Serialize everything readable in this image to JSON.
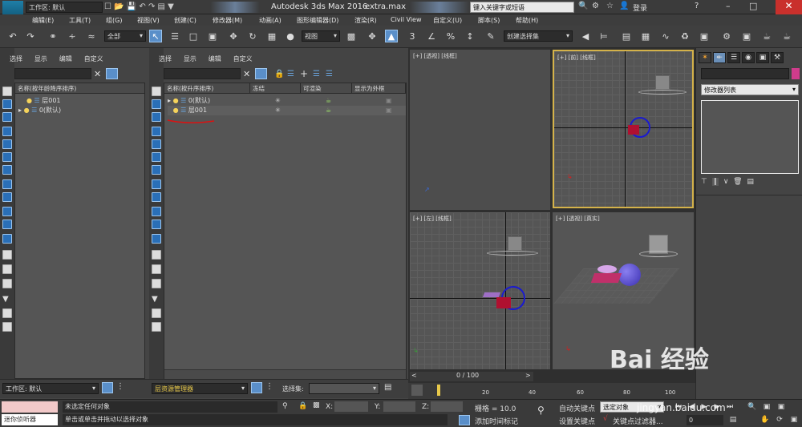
{
  "titlebar": {
    "workspace": "工作区: 默认",
    "app_title": "Autodesk 3ds Max 2016",
    "file_name": "extra.max",
    "search_placeholder": "键入关键字或短语",
    "login": "登录"
  },
  "logo": "MAX",
  "menu": [
    "编辑(E)",
    "工具(T)",
    "组(G)",
    "视图(V)",
    "创建(C)",
    "修改器(M)",
    "动画(A)",
    "图形编辑器(D)",
    "渲染(R)",
    "Civil View",
    "自定义(U)",
    "脚本(S)",
    "帮助(H)"
  ],
  "toolbar": {
    "filter_value": "全部",
    "ref_coord": "视图",
    "create_selection_set": "创建选择集"
  },
  "left_explorer": {
    "tabs": [
      "选择",
      "显示",
      "编辑",
      "自定义"
    ],
    "column_header": "名称(按年龄降序排序)",
    "rows": [
      {
        "name": "层001",
        "expanded": false,
        "indent": 1
      },
      {
        "name": "0(默认)",
        "expanded": false,
        "indent": 0
      }
    ],
    "workspace_label": "工作区: 默认"
  },
  "layer_manager": {
    "tabs": [
      "选择",
      "显示",
      "编辑",
      "自定义"
    ],
    "columns": [
      "名称(按升序排序)",
      "冻结",
      "可渲染",
      "显示为外框"
    ],
    "rows": [
      {
        "name": "0(默认)",
        "expanded": false
      },
      {
        "name": "层001",
        "expanded": false
      }
    ],
    "footer_label": "层资源管理器",
    "selection_set_label": "选择集:"
  },
  "viewports": {
    "top": "[+] [透视] [线框]",
    "front": "[+] [前] [线框]",
    "left": "[+] [左] [线框]",
    "perspective": "[+] [透视] [真实]"
  },
  "command_panel": {
    "modifier_list": "修改器列表"
  },
  "timeline": {
    "frame": "0 / 100",
    "ticks": [
      "20",
      "40",
      "60",
      "80",
      "100"
    ]
  },
  "status": {
    "listener": "迷你侦听器",
    "selection": "未选定任何对象",
    "prompt": "单击或单击并拖动以选择对象",
    "x_label": "X:",
    "y_label": "Y:",
    "z_label": "Z:",
    "grid": "栅格 = 10.0",
    "add_time_tag": "添加时间标记",
    "auto_key": "自动关键点",
    "set_key": "设置关键点",
    "selected_object": "选定对象",
    "key_filters": "关键点过滤器...",
    "frame_value": "0"
  },
  "watermark": {
    "brand": "Bai  经验",
    "url": "jingyan.baidu.com"
  }
}
